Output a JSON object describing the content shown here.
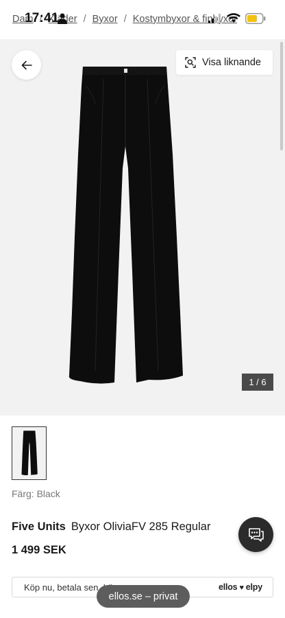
{
  "status_bar": {
    "time": "17:41"
  },
  "breadcrumb": {
    "items": [
      "Dam",
      "Kläder",
      "Byxor",
      "Kostymbyxor & finbyxor"
    ],
    "separator": "/"
  },
  "gallery": {
    "similar_label": "Visa liknande",
    "counter": "1 / 6",
    "background": "#f2f2f2"
  },
  "product": {
    "color_label": "Färg: Black",
    "brand": "Five Units",
    "name": "Byxor OliviaFV 285 Regular",
    "price": "1 499 SEK"
  },
  "paylater": {
    "text": "Köp nu, betala sen. Lä",
    "brand_left": "ellos",
    "brand_right": "elpy"
  },
  "browser": {
    "url_label": "ellos.se – privat"
  },
  "icons": {
    "back": "arrow-left-icon",
    "similar": "visual-search-icon",
    "chat": "chat-icon"
  }
}
